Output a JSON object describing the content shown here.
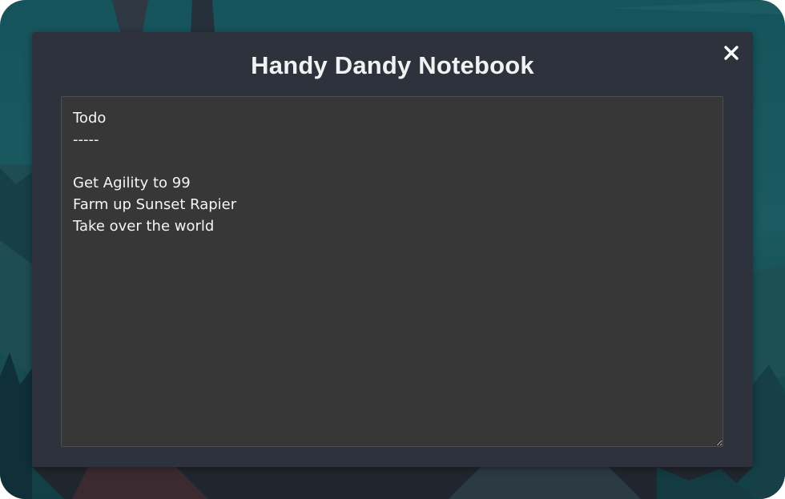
{
  "notebook": {
    "title": "Handy Dandy Notebook",
    "close_icon": "close-icon",
    "notes_text": "Todo\n-----\n\nGet Agility to 99\nFarm up Sunset Rapier\nTake over the world"
  },
  "colors": {
    "modal_background": "#2d323d",
    "textarea_background": "#373737",
    "title_text": "#f2f2f2",
    "scene_teal": "#16545b"
  }
}
